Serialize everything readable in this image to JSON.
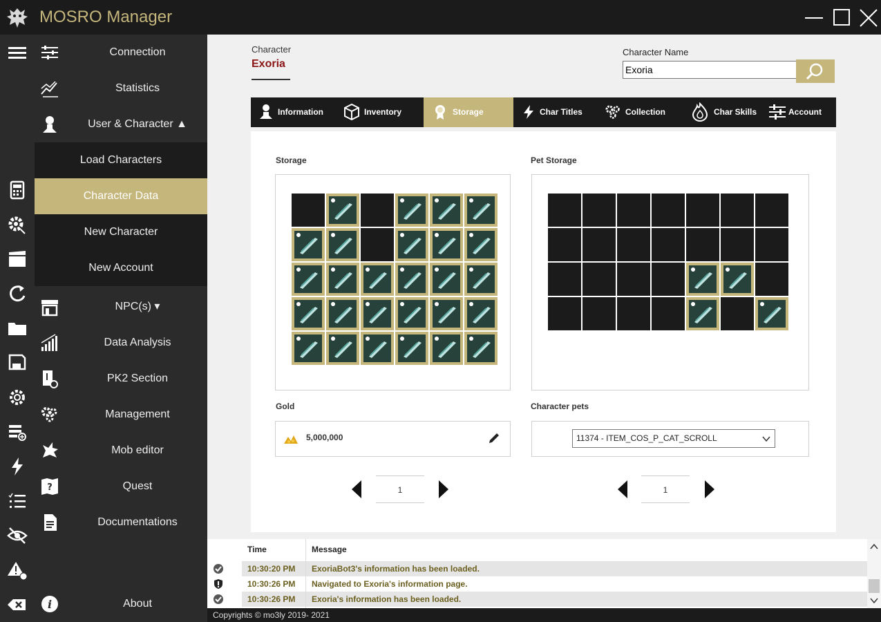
{
  "app": {
    "title": "MOSRO Manager",
    "accent": "#c5b67c",
    "dark": "#1b1b1b",
    "window_buttons": [
      "minimize-icon",
      "maximize-icon",
      "close-icon"
    ]
  },
  "rail": {
    "icons": [
      "menu-icon",
      "calculator-icon",
      "gear-icon",
      "clapperboard-icon",
      "refresh-icon",
      "folder-icon",
      "save-icon",
      "settings-icon",
      "database-add-icon",
      "lightning-icon",
      "list-icon",
      "eye-off-icon",
      "warning-icon",
      "backspace-icon"
    ]
  },
  "nav": {
    "items": [
      {
        "label": "Connection",
        "icon": "sliders-icon"
      },
      {
        "label": "Statistics",
        "icon": "chart-line-icon"
      },
      {
        "label": "User & Character ▲",
        "icon": "user-icon"
      },
      {
        "label": "Load Characters",
        "icon": ""
      },
      {
        "label": "Character Data",
        "icon": ""
      },
      {
        "label": "New Character",
        "icon": ""
      },
      {
        "label": "New Account",
        "icon": ""
      },
      {
        "label": "NPC(s) ▾",
        "icon": "shop-icon"
      },
      {
        "label": "Data Analysis",
        "icon": "bar-chart-icon"
      },
      {
        "label": "PK2 Section",
        "icon": "file-icon"
      },
      {
        "label": "Management",
        "icon": "cogs-icon"
      },
      {
        "label": "Mob editor",
        "icon": "dragon-icon"
      },
      {
        "label": "Quest",
        "icon": "quest-map-icon"
      },
      {
        "label": "Documentations",
        "icon": "document-icon"
      }
    ],
    "about": {
      "label": "About",
      "icon": "info-icon"
    }
  },
  "header": {
    "character_label": "Character",
    "character_value": "Exoria",
    "charname_label": "Character Name",
    "charname_value": "Exoria",
    "search_icon": "search-icon"
  },
  "tabs": [
    {
      "label": "Information",
      "icon": "person-icon"
    },
    {
      "label": "Inventory",
      "icon": "box-icon"
    },
    {
      "label": "Storage",
      "icon": "award-icon"
    },
    {
      "label": "Char Titles",
      "icon": "lightning-icon"
    },
    {
      "label": "Collection",
      "icon": "cogs-icon"
    },
    {
      "label": "Char Skills",
      "icon": "flame-icon"
    },
    {
      "label": "Account",
      "icon": "sliders-icon"
    }
  ],
  "storage": {
    "label": "Storage",
    "grid": [
      [
        0,
        1,
        0,
        1,
        1,
        1
      ],
      [
        1,
        1,
        0,
        1,
        1,
        1
      ],
      [
        1,
        1,
        1,
        1,
        1,
        1
      ],
      [
        1,
        1,
        1,
        1,
        1,
        1
      ],
      [
        1,
        1,
        1,
        1,
        1,
        1
      ]
    ],
    "gold_label": "Gold",
    "gold_value": "5,000,000",
    "gold_icon": "gold-coins-icon",
    "edit_icon": "pencil-icon",
    "page": "1"
  },
  "pet_storage": {
    "label": "Pet Storage",
    "grid": [
      [
        0,
        0,
        0,
        0,
        0,
        0,
        0
      ],
      [
        0,
        0,
        0,
        0,
        0,
        0,
        0
      ],
      [
        0,
        0,
        0,
        0,
        1,
        1,
        0
      ],
      [
        0,
        0,
        0,
        0,
        1,
        0,
        1
      ]
    ],
    "pets_label": "Character pets",
    "pet_selected": "11374 - ITEM_COS_P_CAT_SCROLL",
    "page": "1"
  },
  "log": {
    "headers": {
      "time": "Time",
      "message": "Message"
    },
    "rows": [
      {
        "icon": "check-circle-icon",
        "time": "10:30:20 PM",
        "message": "ExoriaBot3's information has been loaded."
      },
      {
        "icon": "shield-alert-icon",
        "time": "10:30:26 PM",
        "message": "Navigated to Exoria's information page."
      },
      {
        "icon": "check-circle-icon",
        "time": "10:30:26 PM",
        "message": "Exoria's information has been loaded."
      }
    ]
  },
  "footer": {
    "text": "Copyrights © mo3ly 2019- 2021"
  }
}
